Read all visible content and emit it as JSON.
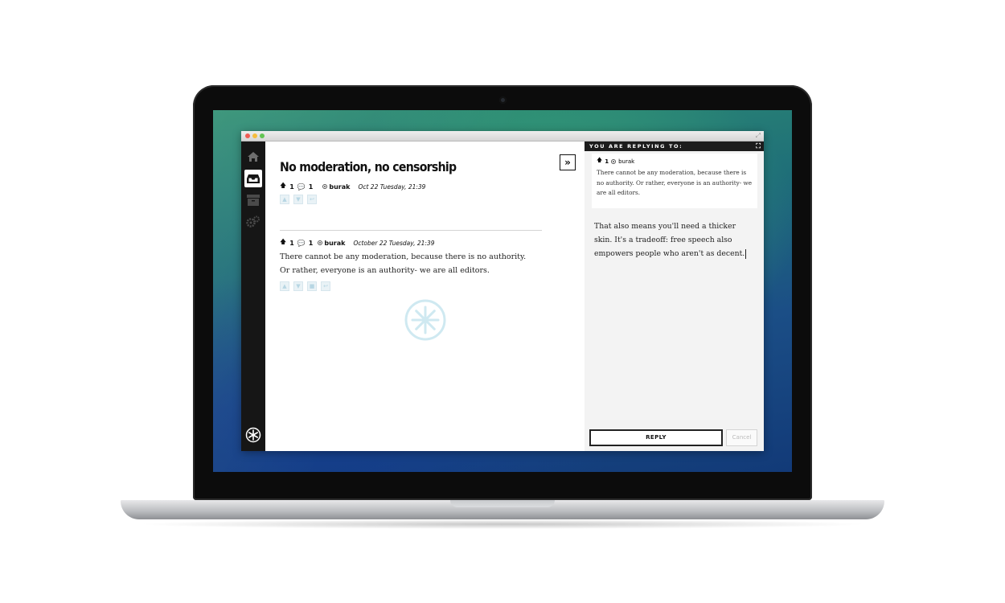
{
  "post": {
    "title": "No moderation, no censorship",
    "upvotes": "1",
    "comments": "1",
    "author": "burak",
    "date": "Oct 22 Tuesday, 21:39"
  },
  "comment": {
    "upvotes": "1",
    "replies": "1",
    "author": "burak",
    "date": "October 22 Tuesday, 21:39",
    "body": "There cannot be any moderation, because there is no authority. Or rather, everyone is an authority- we are all editors."
  },
  "reply_panel": {
    "header": "YOU ARE REPLYING TO:",
    "quote_upvotes": "1",
    "quote_author": "burak",
    "quote_text": "There cannot be any moderation, because there is no authority. Or rather, everyone is an authority- we are all editors.",
    "draft": "That also means you'll need a thicker skin. It's a tradeoff: free speech also empowers people who aren't as decent.",
    "reply_label": "REPLY",
    "cancel_label": "Cancel"
  },
  "colors": {
    "sidebar": "#161616",
    "accent_spinner": "#bfe3ee",
    "reply_panel_bg": "#f3f3f3"
  },
  "icons": {
    "sidebar": [
      "home-icon",
      "inbox-icon",
      "archive-icon",
      "settings-icon",
      "app-logo-icon"
    ],
    "collapse": "double-chevron-right-icon"
  }
}
